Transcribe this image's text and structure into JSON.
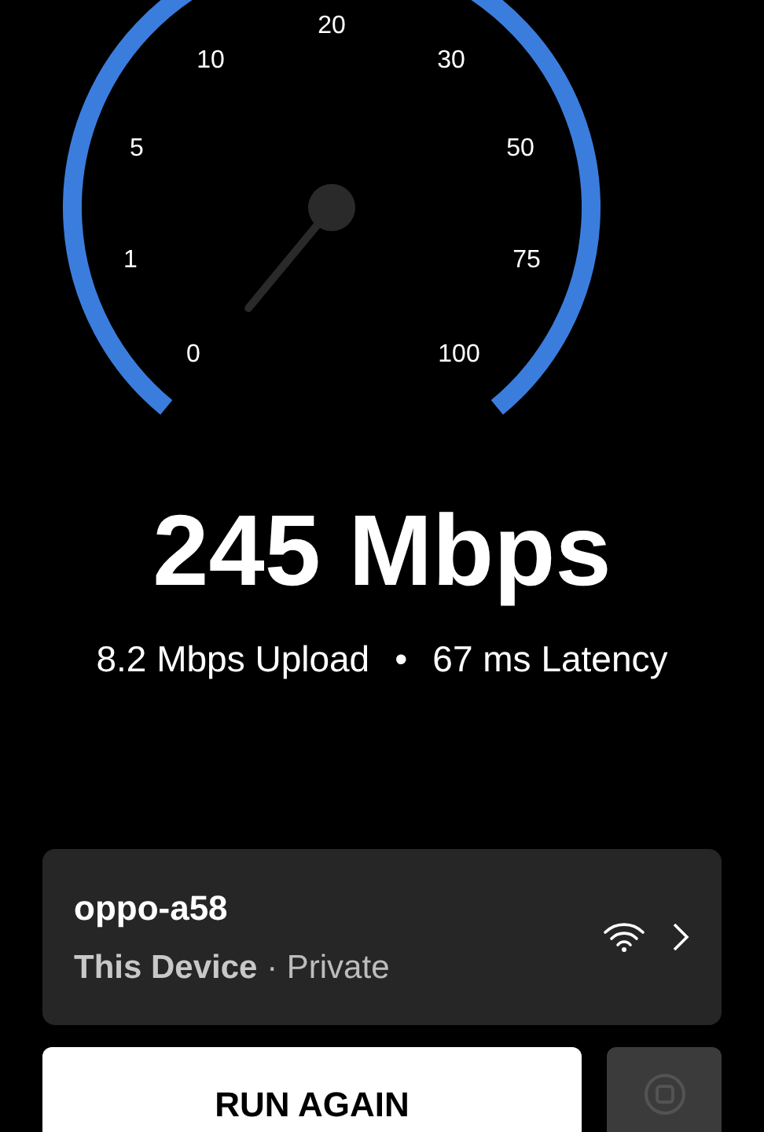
{
  "gauge": {
    "ticks": [
      {
        "label": "20"
      },
      {
        "label": "10"
      },
      {
        "label": "30"
      },
      {
        "label": "5"
      },
      {
        "label": "50"
      },
      {
        "label": "1"
      },
      {
        "label": "75"
      },
      {
        "label": "0"
      },
      {
        "label": "100"
      }
    ]
  },
  "result": {
    "speed": "245 Mbps",
    "upload": "8.2 Mbps Upload",
    "separator": "•",
    "latency": "67 ms Latency"
  },
  "device": {
    "name": "oppo-a58",
    "detail": "**This Device** · Private"
  },
  "buttons": [
    {
      "kind": "primary",
      "label": "RUN AGAIN",
      "disabled": false
    },
    {
      "kind": "stop",
      "disabled": true
    }
  ]
}
